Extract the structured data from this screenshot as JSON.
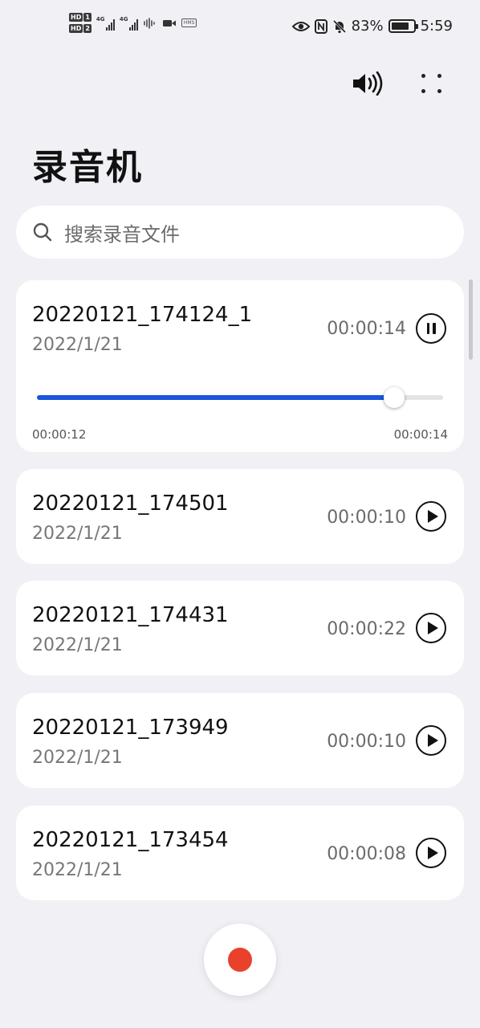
{
  "status_bar": {
    "hd1": "HD",
    "hd1_num": "1",
    "hd2": "HD",
    "hd2_num": "2",
    "net1": "4G",
    "net2": "4G",
    "hms": "HMS",
    "battery_percent": "83%",
    "battery_level": 0.83,
    "time": "5:59"
  },
  "header": {
    "title": "录音机"
  },
  "search": {
    "placeholder": "搜索录音文件"
  },
  "recordings": [
    {
      "name": "20220121_174124_1",
      "date": "2022/1/21",
      "duration": "00:00:14",
      "state": "playing",
      "progress": {
        "elapsed": "00:00:12",
        "total": "00:00:14",
        "fraction": 0.88
      }
    },
    {
      "name": "20220121_174501",
      "date": "2022/1/21",
      "duration": "00:00:10",
      "state": "stopped"
    },
    {
      "name": "20220121_174431",
      "date": "2022/1/21",
      "duration": "00:00:22",
      "state": "stopped"
    },
    {
      "name": "20220121_173949",
      "date": "2022/1/21",
      "duration": "00:00:10",
      "state": "stopped"
    },
    {
      "name": "20220121_173454",
      "date": "2022/1/21",
      "duration": "00:00:08",
      "state": "stopped"
    }
  ],
  "colors": {
    "accent": "#1a56db",
    "record": "#e8412c",
    "background": "#f1f1f5"
  },
  "icons": {
    "speaker": "speaker-icon",
    "more": "more-grid-icon",
    "search": "search-icon",
    "pause": "pause-icon",
    "play": "play-icon",
    "record": "record-icon"
  }
}
